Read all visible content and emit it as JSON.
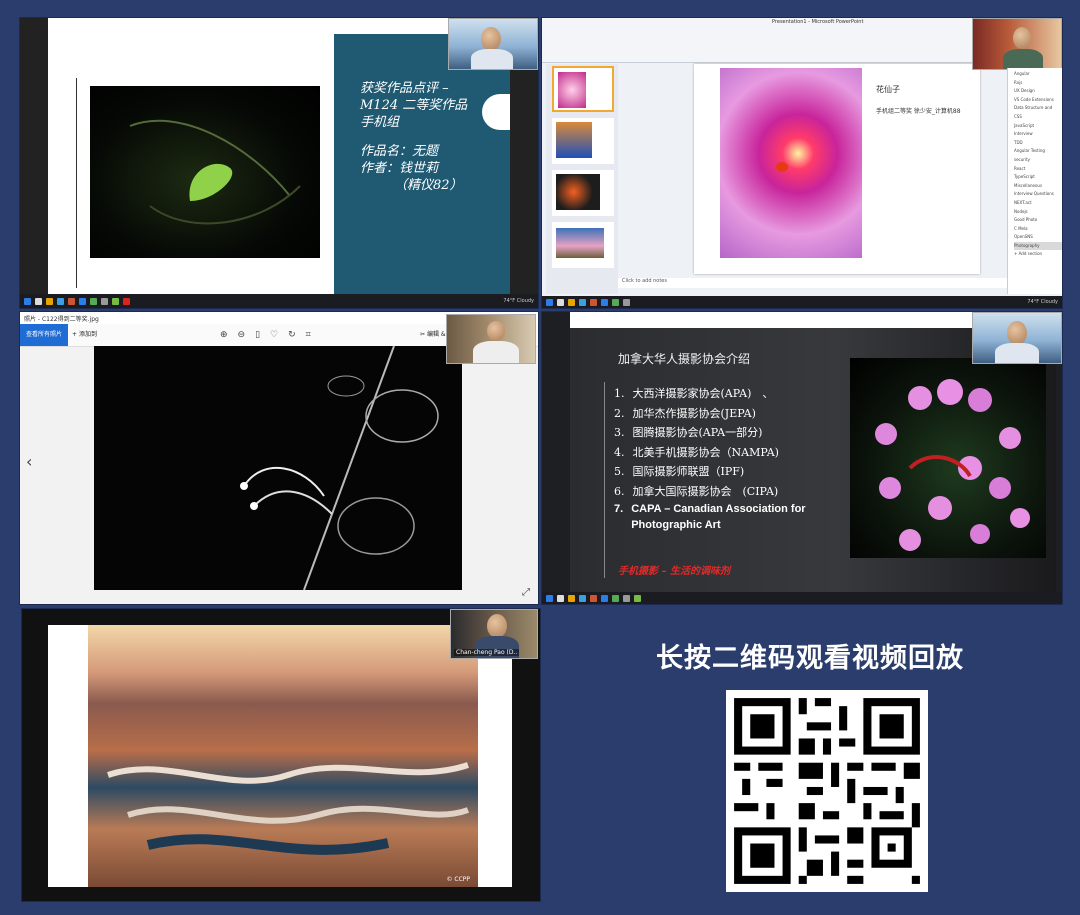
{
  "panel1": {
    "title_line1": "获奖作品点评 –",
    "title_line2": "M124 二等奖作品",
    "title_line3": "手机组",
    "work_name": "作品名：无题",
    "author": "作者：钱世莉",
    "author_note": "（精仪82）"
  },
  "panel2": {
    "window_title": "Presentation1 - Microsoft PowerPoint",
    "slide_title": "花仙子",
    "slide_subtitle": "手机组二等奖 徐少安_计算机88",
    "notes_placeholder": "Click to add notes",
    "sidebar_items": [
      "Angular",
      "Rxjs",
      "UX Design",
      "VS Code Extensions",
      "Data Structure and",
      "CSS",
      "JavaScript",
      "Interview",
      "TDD",
      "Angular Testing",
      "security",
      "React",
      "TypeScript",
      "Miscellaneous",
      "Interview Questions",
      "NEXT.act",
      "Nodejs",
      "Good Photo",
      "C Mela",
      "OpenSNS",
      "Photography"
    ],
    "sidebar_add": "+ Add section"
  },
  "panel3": {
    "back_button": "查看所有照片",
    "add_button": "添加到",
    "filename": "照片 - C122得到二等奖.jpg",
    "edit_label": "编辑 & 创建"
  },
  "panel4": {
    "heading": "加拿大华人摄影协会介绍",
    "items": [
      {
        "num": "1.",
        "text": "大西洋摄影家协会(APA)　、"
      },
      {
        "num": "2.",
        "text": "加华杰作摄影协会(JEPA)"
      },
      {
        "num": "3.",
        "text": "图腾摄影协会(APA一部分)"
      },
      {
        "num": "4.",
        "text": "北美手机摄影协会（NAMPA)"
      },
      {
        "num": "5.",
        "text": "国际摄影师联盟（IPF)"
      },
      {
        "num": "6.",
        "text": "加拿大国际摄影协会　(CIPA)"
      },
      {
        "num": "7.",
        "text": "CAPA – Canadian Association for Photographic Art"
      }
    ],
    "slogan": "手机摄影 – 生活的调味剂"
  },
  "panel5": {
    "cam_name": "Chan-cheng Pao (D..",
    "watermark": "© CCPP"
  },
  "qr_caption": "长按二维码观看视频回放",
  "colors": {
    "background": "#2b3d6c",
    "slide_teal": "#1f5a72",
    "slogan_red": "#e02a2a"
  }
}
